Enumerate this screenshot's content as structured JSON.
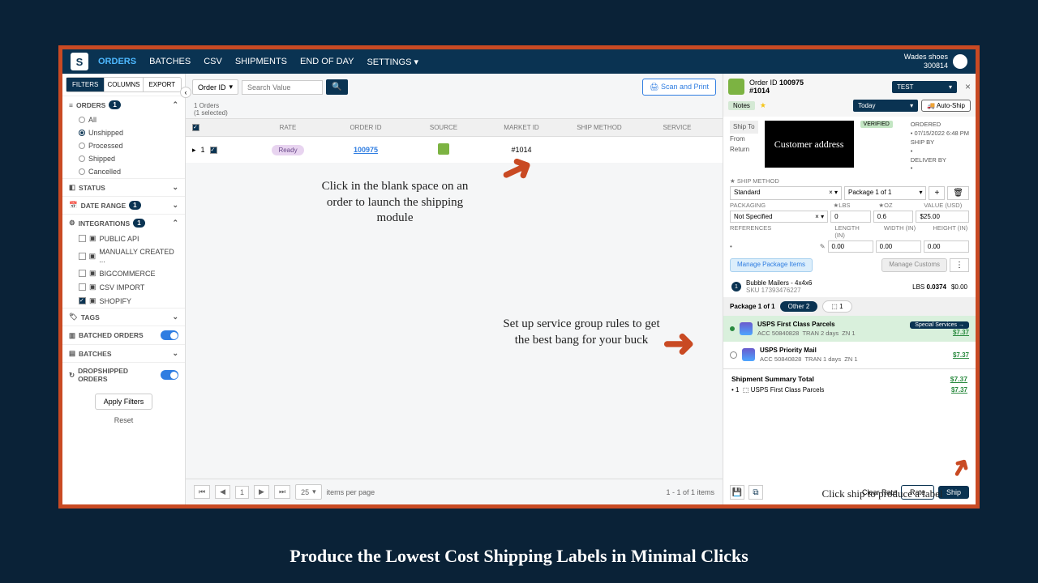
{
  "caption": "Produce the Lowest Cost Shipping Labels in Minimal Clicks",
  "nav": {
    "items": [
      "ORDERS",
      "BATCHES",
      "CSV",
      "SHIPMENTS",
      "END OF DAY",
      "SETTINGS ▾"
    ],
    "active": "ORDERS"
  },
  "user": {
    "name": "Wades shoes",
    "id": "300814"
  },
  "sidebar": {
    "tabs": [
      "FILTERS",
      "COLUMNS",
      "EXPORT"
    ],
    "orders": {
      "label": "ORDERS",
      "count": "1",
      "options": [
        "All",
        "Unshipped",
        "Processed",
        "Shipped",
        "Cancelled"
      ],
      "selected": "Unshipped"
    },
    "status": "STATUS",
    "daterange": {
      "label": "DATE RANGE",
      "count": "1"
    },
    "integrations": {
      "label": "INTEGRATIONS",
      "count": "1",
      "items": [
        "PUBLIC API",
        "MANUALLY CREATED ...",
        "BIGCOMMERCE",
        "CSV IMPORT",
        "SHOPIFY"
      ],
      "checked": "SHOPIFY"
    },
    "tags": "TAGS",
    "batched": "BATCHED ORDERS",
    "batches": "BATCHES",
    "drop": "DROPSHIPPED ORDERS",
    "apply": "Apply Filters",
    "reset": "Reset"
  },
  "search": {
    "field": "Order ID",
    "placeholder": "Search Value"
  },
  "scan": "Scan and Print",
  "table": {
    "meta1": "1 Orders",
    "meta2": "(1 selected)",
    "headers": [
      "",
      "RATE",
      "ORDER ID",
      "SOURCE",
      "MARKET ID",
      "SHIP METHOD",
      "SERVICE"
    ],
    "row": {
      "n": "1",
      "status": "Ready",
      "order_id": "100975",
      "market_id": "#1014"
    }
  },
  "pager": {
    "page": "1",
    "per": "25",
    "per_label": "items per page",
    "range": "1 - 1 of 1 items"
  },
  "annot1": "Click in the blank space on an order to launch the shipping module",
  "annot2": "Set up service group rules to get the best bang for your buck",
  "annot3": "Click ship to produce a label",
  "panel": {
    "order_id_label": "Order ID",
    "order_id": "100975",
    "market": "#1014",
    "test": "TEST",
    "today": "Today",
    "notes": "Notes",
    "auto": "Auto-Ship",
    "tabs": {
      "shipto": "Ship To",
      "from": "From",
      "return": "Return"
    },
    "blackbox": "Customer address",
    "verified": "VERIFIED",
    "right": {
      "ordered": "ORDERED",
      "date": "07/15/2022 6:48 PM",
      "shipby": "SHIP BY",
      "deliver": "DELIVER BY"
    },
    "shipmethod_label": "SHIP METHOD",
    "shipmethod": "Standard",
    "pkg_of": "Package 1 of 1",
    "packaging_label": "PACKAGING",
    "packaging": "Not Specified",
    "lbs_l": "LBS",
    "lbs": "0",
    "oz_l": "OZ",
    "oz": "0.6",
    "val_l": "VALUE (USD)",
    "val": "$25.00",
    "ref_l": "REFERENCES",
    "len_l": "LENGTH (IN)",
    "len": "0.00",
    "wid_l": "WIDTH (IN)",
    "wid": "0.00",
    "hei_l": "HEIGHT (IN)",
    "hei": "0.00",
    "mpi": "Manage Package Items",
    "mc": "Manage Customs",
    "item": {
      "name": "Bubble Mailers - 4x4x6",
      "sku": "SKU 17393476227",
      "wl": "LBS",
      "w": "0.0374",
      "p": "$0.00"
    },
    "svc_hdr": "Package 1 of 1",
    "pill_other": "Other",
    "pill_ups": "1",
    "svc1": {
      "name": "USPS First Class Parcels",
      "acc": "ACC 50840828",
      "tran": "TRAN 2 days",
      "zn": "ZN 1",
      "price": "$7.37",
      "ss": "Special Services →"
    },
    "svc2": {
      "name": "USPS Priority Mail",
      "acc": "ACC 50840828",
      "tran": "TRAN 1 days",
      "zn": "ZN 1",
      "price": "$7.37"
    },
    "summary": {
      "title": "Shipment Summary Total",
      "total": "$7.37",
      "line": "USPS First Class Parcels",
      "lp": "$7.37"
    },
    "actions": {
      "clear": "Clear Rate",
      "rate": "Rate",
      "ship": "Ship"
    }
  }
}
